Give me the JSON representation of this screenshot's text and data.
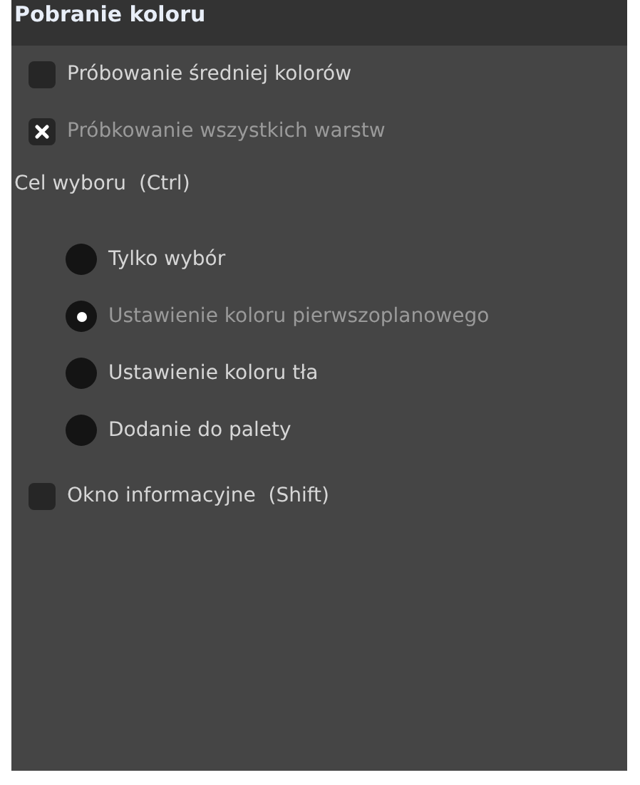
{
  "title": "Pobranie koloru",
  "options": [
    {
      "kind": "checkbox",
      "label": "Próbowanie średniej kolorów",
      "checked": false
    },
    {
      "kind": "checkbox",
      "label": "Próbkowanie wszystkich warstw",
      "checked": true
    }
  ],
  "target": {
    "label": "Cel wyboru  (Ctrl)",
    "choices": [
      {
        "label": "Tylko wybór",
        "selected": false
      },
      {
        "label": "Ustawienie koloru pierwszoplanowego",
        "selected": true
      },
      {
        "label": "Ustawienie koloru tła",
        "selected": false
      },
      {
        "label": "Dodanie do palety",
        "selected": false
      }
    ]
  },
  "info": {
    "kind": "checkbox",
    "label": "Okno informacyjne  (Shift)",
    "checked": false
  }
}
